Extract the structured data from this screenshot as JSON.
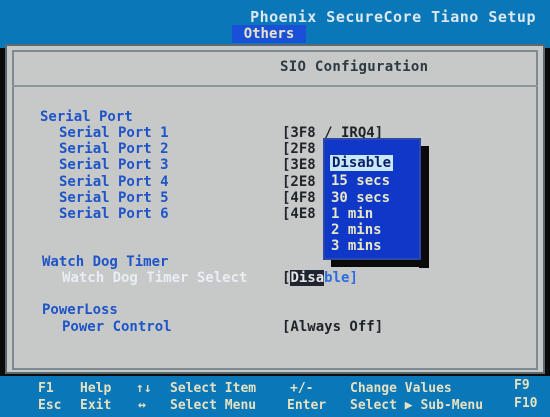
{
  "header": {
    "title": "Phoenix SecureCore Tiano Setup",
    "active_tab": "Others"
  },
  "panel": {
    "title": "SIO Configuration"
  },
  "serial_port": {
    "section": "Serial Port",
    "items": [
      {
        "label": "Serial Port 1",
        "value": "[3F8 / IRQ4]"
      },
      {
        "label": "Serial Port 2",
        "value": "[2F8"
      },
      {
        "label": "Serial Port 3",
        "value": "[3E8"
      },
      {
        "label": "Serial Port 4",
        "value": "[2E8"
      },
      {
        "label": "Serial Port 5",
        "value": "[4F8"
      },
      {
        "label": "Serial Port 6",
        "value": "[4E8"
      }
    ]
  },
  "watchdog": {
    "section": "Watch Dog Timer",
    "label": "Watch Dog Timer Select",
    "value_bracket": "[",
    "value_selected": "Disa",
    "value_rest": "ble]"
  },
  "popup": {
    "options": [
      "Disable",
      "15 secs",
      "30 secs",
      "1 min",
      "2 mins",
      "3 mins"
    ],
    "selected_index": 0
  },
  "powerloss": {
    "section": "PowerLoss",
    "label": "Power Control",
    "value": "[Always Off]"
  },
  "help": {
    "f1": "F1",
    "f1_desc": "Help",
    "esc": "Esc",
    "esc_desc": "Exit",
    "updown": "↑↓",
    "updown_desc": "Select Item",
    "leftright": "↔",
    "leftright_desc": "Select Menu",
    "plusminus": "+/-",
    "plusminus_desc": "Change Values",
    "enter": "Enter",
    "enter_desc": "Select ▶ Sub-Menu",
    "f9": "F9",
    "f10": "F10"
  },
  "colors": {
    "title_bar": "#0a78b8",
    "panel_bg": "#c7c9c9",
    "label_blue": "#1d54c8",
    "popup_bg": "#1038c8"
  }
}
